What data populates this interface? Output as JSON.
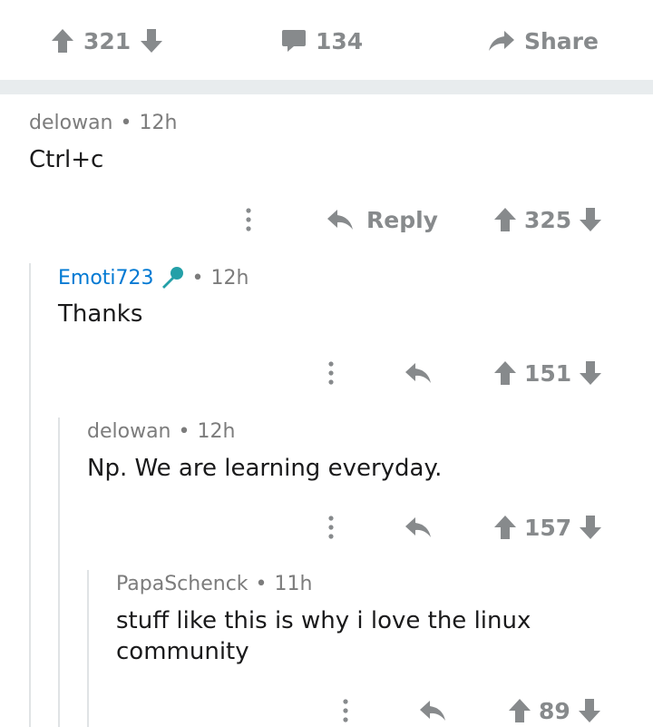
{
  "post_bar": {
    "upvotes": "321",
    "comments": "134",
    "share_label": "Share"
  },
  "comments": [
    {
      "author": "delowan",
      "time": "12h",
      "body": "Ctrl+c",
      "reply_label": "Reply",
      "score": "325"
    },
    {
      "author": "Emoti723",
      "time": "12h",
      "body": "Thanks",
      "score": "151"
    },
    {
      "author": "delowan",
      "time": "12h",
      "body": "Np. We are learning everyday.",
      "score": "157"
    },
    {
      "author": "PapaSchenck",
      "time": "11h",
      "body": "stuff like this is why i love the linux community",
      "score": "89"
    }
  ],
  "colors": {
    "icon_gray": "#878a8c",
    "op_blue": "#0079d3",
    "mic_teal": "#24a0a8"
  }
}
